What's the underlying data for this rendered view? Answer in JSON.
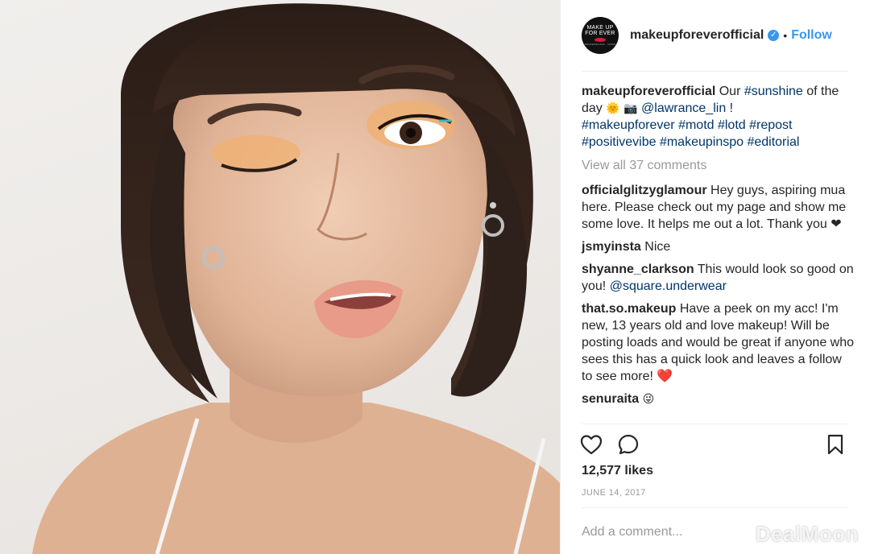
{
  "post": {
    "username": "makeupforeverofficial",
    "follow_label": "Follow",
    "dot": "•",
    "avatar_lines": [
      "MAKE UP",
      "FOR EVER"
    ],
    "avatar_small": "PROFESSIONAL · PARIS"
  },
  "caption": {
    "username": "makeupforeverofficial",
    "text_1": "Our",
    "tag_sunshine": "#sunshine",
    "text_2": "of the day",
    "emoji_sun": "🌞",
    "emoji_camera": "📷",
    "mention": "@lawrance_lin",
    "text_3": "!",
    "hashtags_line1": "#makeupforever #motd #lotd #repost",
    "hashtags_line2": "#positivevibe #makeupinspo #editorial"
  },
  "view_all_comments": "View all 37 comments",
  "comments": [
    {
      "user": "officialglitzyglamour",
      "text": "Hey guys, aspiring mua here. Please check out my page and show me some love. It helps me out a lot. Thank you",
      "emoji": "❤"
    },
    {
      "user": "jsmyinsta",
      "text": "Nice"
    },
    {
      "user": "shyanne_clarkson",
      "text": "This would look so good on you!",
      "mention": "@square.underwear"
    },
    {
      "user": "that.so.makeup",
      "text": "Have a peek on my acc! I'm new, 13 years old and love makeup! Will be posting loads and would be great if anyone who sees this has a quick look and leaves a follow to see more!",
      "emoji": "❤️"
    },
    {
      "user": "senuraita",
      "emoji": "😜"
    }
  ],
  "likes": "12,577 likes",
  "date": "JUNE 14, 2017",
  "add_comment_placeholder": "Add a comment...",
  "watermark": "DealMoon",
  "icons": {
    "like": "heart-outline-icon",
    "comment": "speech-bubble-icon",
    "save": "bookmark-icon",
    "verified": "verified-badge-icon"
  },
  "colors": {
    "link_blue": "#3897f0",
    "hashtag": "#003569",
    "muted": "#999999",
    "text": "#262626"
  }
}
